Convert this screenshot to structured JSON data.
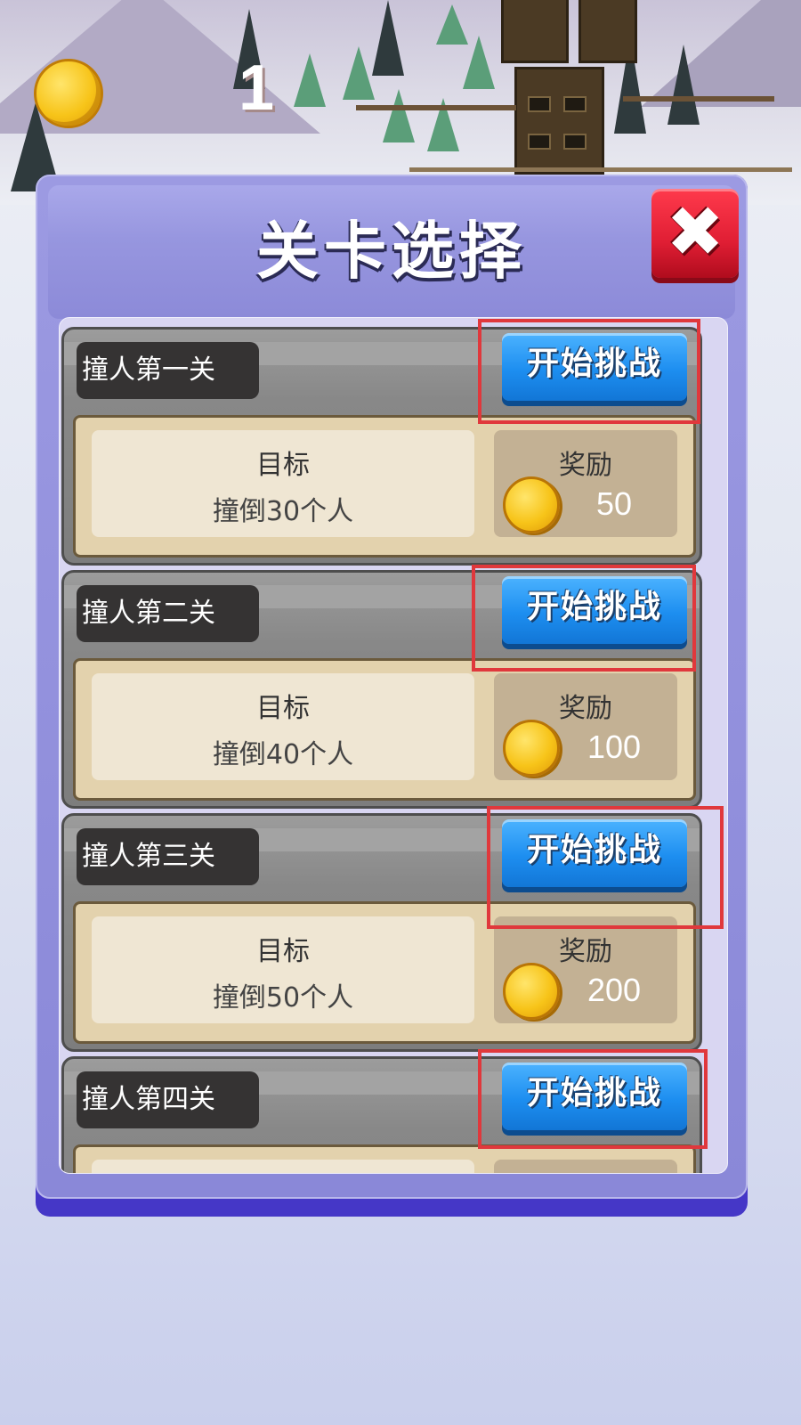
{
  "hud": {
    "coins": "1"
  },
  "dialog": {
    "title": "关卡选择",
    "close_label": "✖"
  },
  "levels": [
    {
      "name": "撞人第一关",
      "start_label": "开始挑战",
      "goal_title": "目标",
      "goal": "撞倒30个人",
      "reward_title": "奖励",
      "reward": "50"
    },
    {
      "name": "撞人第二关",
      "start_label": "开始挑战",
      "goal_title": "目标",
      "goal": "撞倒40个人",
      "reward_title": "奖励",
      "reward": "100"
    },
    {
      "name": "撞人第三关",
      "start_label": "开始挑战",
      "goal_title": "目标",
      "goal": "撞倒50个人",
      "reward_title": "奖励",
      "reward": "200"
    },
    {
      "name": "撞人第四关",
      "start_label": "开始挑战"
    }
  ],
  "colors": {
    "start_button": "#1d8ef0",
    "close_button": "#e01e34",
    "highlight": "#e0383c",
    "panel": "#8a88d8"
  }
}
